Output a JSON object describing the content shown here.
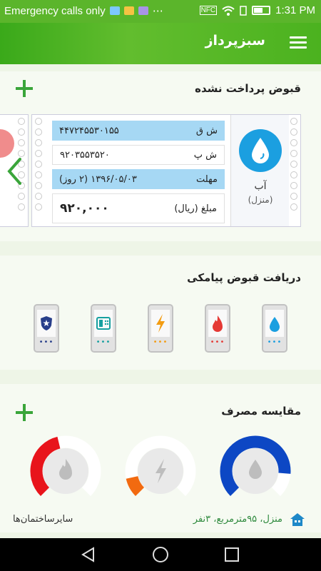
{
  "status_bar": {
    "left_text": "Emergency calls only",
    "time": "1:31 PM",
    "icons": [
      "cafe-bazaar-icon",
      "photos-icon",
      "message-icon",
      "more-icon",
      "nfc-icon",
      "wifi-icon",
      "sim-icon",
      "battery-icon"
    ]
  },
  "app_bar": {
    "title": "سبزپرداز",
    "menu_icon": "hamburger-icon"
  },
  "unpaid_bills": {
    "title": "قبوض پرداخت نشده",
    "add_icon": "plus-icon",
    "bill": {
      "type_name": "آب",
      "type_sub": "(منزل)",
      "icon": "water-drop-icon",
      "rows": [
        {
          "label": "ش ق",
          "value": "۴۴۷۲۴۵۵۳۰۱۵۵"
        },
        {
          "label": "ش پ",
          "value": "۹۲۰۳۵۵۳۵۲۰"
        },
        {
          "label": "مهلت",
          "value": "۱۳۹۶/۰۵/۰۳ (۲ روز)"
        }
      ],
      "amount_label": "مبلغ (ریال)",
      "amount_value": "۹۲۰,۰۰۰"
    },
    "accent": "#1b9fe0",
    "highlight": "#a6d8f4"
  },
  "sms_bills": {
    "title": "دریافت قبوض پیامکی",
    "phones": [
      {
        "icon": "water-drop-icon",
        "color": "#1b9fe0"
      },
      {
        "icon": "flame-icon",
        "color": "#e53935"
      },
      {
        "icon": "lightning-icon",
        "color": "#f39c12"
      },
      {
        "icon": "telephone-icon",
        "color": "#16a0a0"
      },
      {
        "icon": "police-badge-icon",
        "color": "#283e8a"
      }
    ]
  },
  "consumption": {
    "title": "مقایسه مصرف",
    "add_icon": "plus-icon",
    "gauges": [
      {
        "icon": "water-drop-icon",
        "color": "#0d47c4",
        "level": 0.85
      },
      {
        "icon": "lightning-icon",
        "color": "#f26a10",
        "level": 0.12
      },
      {
        "icon": "flame-icon",
        "color": "#e8141b",
        "level": 0.45
      }
    ],
    "household": "منزل، ۹۵مترمربع، ۳نفر",
    "other_buildings": "سایرساختمان‌ها"
  },
  "nav_bar": {
    "buttons": [
      "back-icon",
      "home-icon",
      "recent-apps-icon"
    ]
  }
}
